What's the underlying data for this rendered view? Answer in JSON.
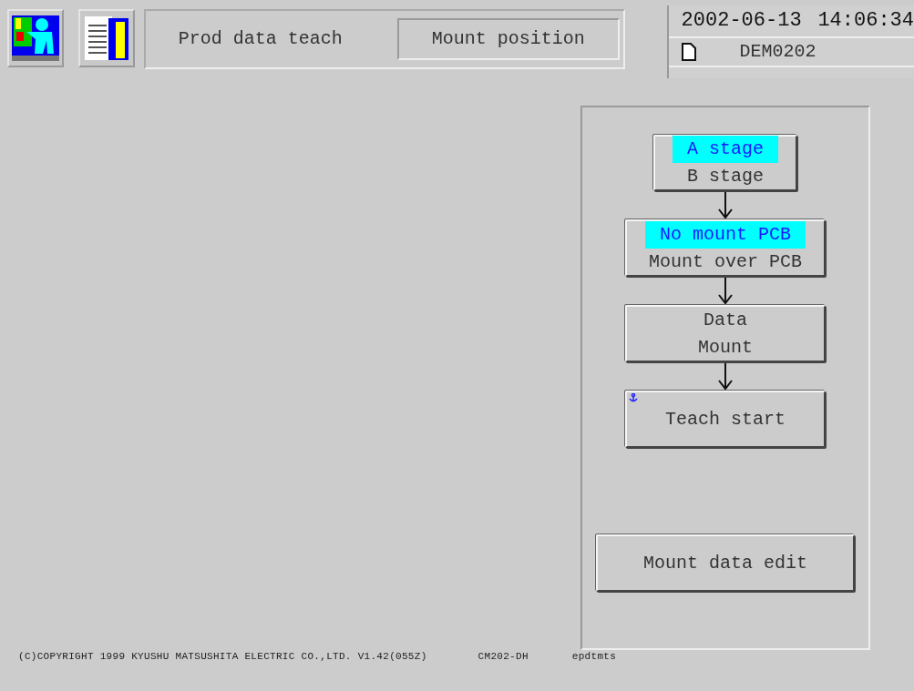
{
  "header": {
    "title": "Prod data teach",
    "mode": "Mount position",
    "date": "2002-06-13",
    "time": "14:06:34",
    "file": "DEM0202"
  },
  "flow": [
    {
      "kind": "toggle",
      "options": [
        {
          "label": "A stage",
          "selected": true
        },
        {
          "label": "B stage",
          "selected": false
        }
      ]
    },
    {
      "kind": "toggle",
      "options": [
        {
          "label": "No mount PCB",
          "selected": true
        },
        {
          "label": "Mount over PCB",
          "selected": false
        }
      ]
    },
    {
      "kind": "button",
      "lines": [
        "Data",
        "Mount"
      ]
    },
    {
      "kind": "start",
      "lines": [
        "Teach start"
      ]
    }
  ],
  "edit_button": "Mount data edit",
  "footer": [
    "(C)COPYRIGHT 1999 KYUSHU MATSUSHITA ELECTRIC CO.,LTD. V1.42(055Z)",
    "CM202-DH",
    "epdtmts"
  ]
}
